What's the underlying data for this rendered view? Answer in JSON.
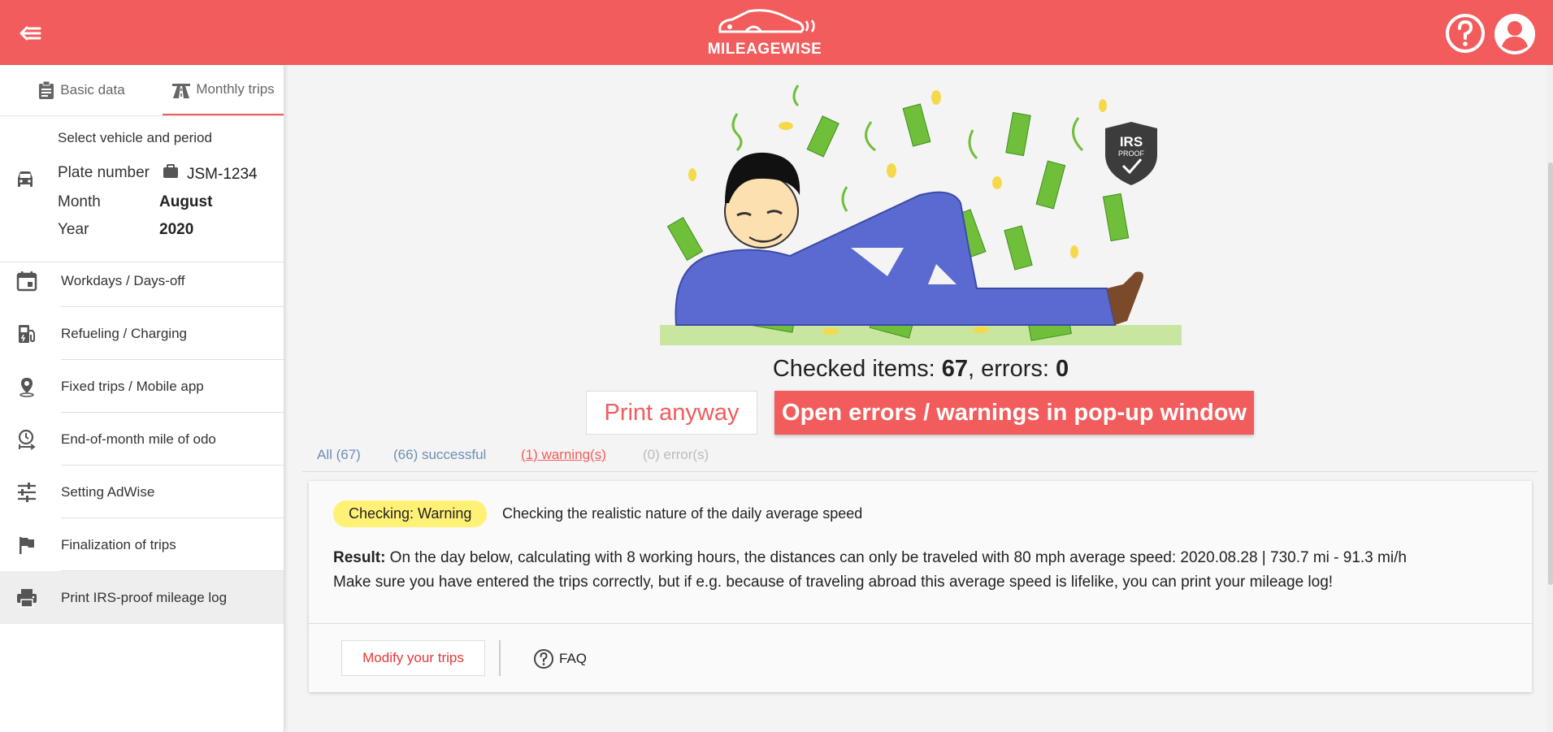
{
  "colors": {
    "brand": "#f25c5c",
    "link": "#6b8fb3",
    "warning_badge": "#fff176"
  },
  "header": {
    "logo_text": "MILEAGEWISE",
    "menu_icon": "arrow-back-menu-icon",
    "help_icon": "help-circle-icon",
    "user_icon": "account-circle-icon"
  },
  "sidebar": {
    "tabs": [
      {
        "label": "Basic data",
        "icon": "clipboard-icon"
      },
      {
        "label": "Monthly trips",
        "icon": "road-icon"
      }
    ],
    "vehicle": {
      "title": "Select vehicle and period",
      "plate_label": "Plate number",
      "plate_value": "JSM-1234",
      "month_label": "Month",
      "month_value": "August",
      "year_label": "Year",
      "year_value": "2020"
    },
    "items": [
      {
        "label": "Workdays / Days-off",
        "icon": "calendar-icon"
      },
      {
        "label": "Refueling / Charging",
        "icon": "fuel-pump-icon"
      },
      {
        "label": "Fixed trips / Mobile app",
        "icon": "location-pin-icon"
      },
      {
        "label": "End-of-month mile of odo",
        "icon": "clock-arrow-icon"
      },
      {
        "label": "Setting AdWise",
        "icon": "sliders-icon"
      },
      {
        "label": "Finalization of trips",
        "icon": "flag-icon"
      },
      {
        "label": "Print IRS-proof mileage log",
        "icon": "printer-icon"
      }
    ]
  },
  "illustration": {
    "badge_line1": "IRS",
    "badge_line2": "PROOF"
  },
  "summary": {
    "prefix": "Checked items: ",
    "items_count": "67",
    "middle": ", errors: ",
    "errors_count": "0"
  },
  "buttons": {
    "print_anyway": "Print anyway",
    "open_errors": "Open errors / warnings in pop-up window",
    "modify_trips": "Modify your trips",
    "faq": "FAQ"
  },
  "filters": {
    "all": "All (67)",
    "successful": "(66) successful",
    "warnings": "(1) warning(s)",
    "errors": "(0) error(s)"
  },
  "warning_card": {
    "badge": "Checking: Warning",
    "title": "Checking the realistic nature of the daily average speed",
    "result_label": "Result:",
    "result_text": " On the day below, calculating with 8 working hours, the distances can only be traveled with 80 mph average speed: 2020.08.28 | 730.7 mi - 91.3 mi/h",
    "result_note": "Make sure you have entered the trips correctly, but if e.g. because of traveling abroad this average speed is lifelike, you can print your mileage log!"
  }
}
